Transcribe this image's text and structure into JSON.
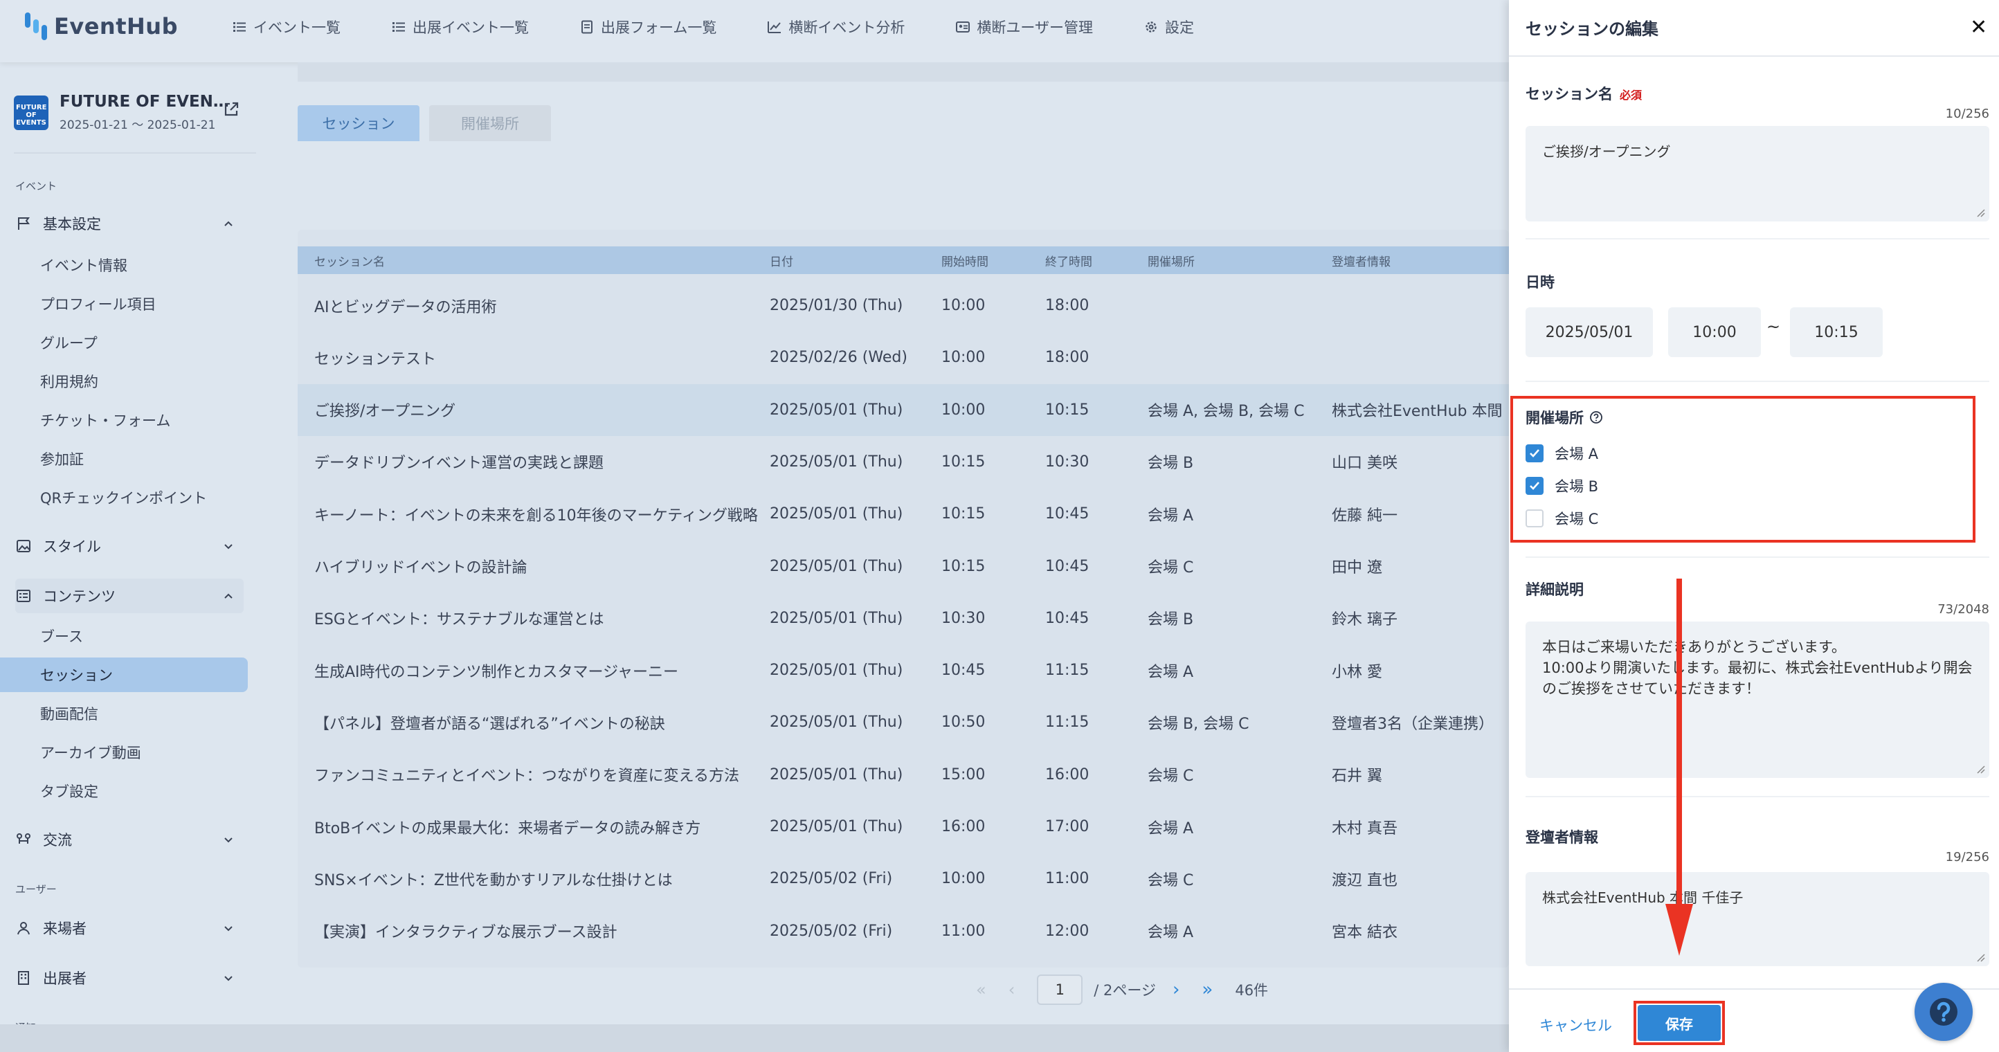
{
  "app": {
    "logo_text": "EventHub"
  },
  "nav": {
    "items": [
      {
        "label": "イベント一覧",
        "icon": "list-icon"
      },
      {
        "label": "出展イベント一覧",
        "icon": "list-icon"
      },
      {
        "label": "出展フォーム一覧",
        "icon": "document-icon"
      },
      {
        "label": "横断イベント分析",
        "icon": "chart-icon"
      },
      {
        "label": "横断ユーザー管理",
        "icon": "user-card-icon"
      },
      {
        "label": "設定",
        "icon": "gear-icon"
      }
    ]
  },
  "event": {
    "thumb_text": "FUTURE OF EVENTS",
    "name": "FUTURE OF EVEN…",
    "dates": "2025-01-21 ～ 2025-01-21"
  },
  "sidebar": {
    "section_event": "イベント",
    "basic": {
      "label": "基本設定",
      "icon": "flag-icon"
    },
    "basic_children": [
      "イベント情報",
      "プロフィール項目",
      "グループ",
      "利用規約",
      "チケット・フォーム",
      "参加証",
      "QRチェックインポイント"
    ],
    "style": {
      "label": "スタイル",
      "icon": "image-icon"
    },
    "contents": {
      "label": "コンテンツ",
      "icon": "contents-icon"
    },
    "contents_children": [
      "ブース",
      "セッション",
      "動画配信",
      "アーカイブ動画",
      "タブ設定"
    ],
    "exchange": {
      "label": "交流",
      "icon": "network-icon"
    },
    "section_user": "ユーザー",
    "visitors": {
      "label": "来場者",
      "icon": "person-icon"
    },
    "exhibitors": {
      "label": "出展者",
      "icon": "building-icon"
    },
    "section_notice": "通知"
  },
  "tabs": {
    "session": "セッション",
    "venue": "開催場所"
  },
  "table": {
    "headers": [
      "セッション名",
      "日付",
      "開始時間",
      "終了時間",
      "開催場所",
      "登壇者情報"
    ],
    "rows": [
      [
        "AIとビッグデータの活用術",
        "2025/01/30 (Thu)",
        "10:00",
        "18:00",
        "",
        ""
      ],
      [
        "セッションテスト",
        "2025/02/26 (Wed)",
        "10:00",
        "18:00",
        "",
        ""
      ],
      [
        "ご挨拶/オープニング",
        "2025/05/01 (Thu)",
        "10:00",
        "10:15",
        "会場 A, 会場 B, 会場 C",
        "株式会社EventHub 本間 千"
      ],
      [
        "データドリブンイベント運営の実践と課題",
        "2025/05/01 (Thu)",
        "10:15",
        "10:30",
        "会場 B",
        "山口 美咲"
      ],
      [
        "キーノート：イベントの未来を創る10年後のマーケティング戦略",
        "2025/05/01 (Thu)",
        "10:15",
        "10:45",
        "会場 A",
        "佐藤 純一"
      ],
      [
        "ハイブリッドイベントの設計論",
        "2025/05/01 (Thu)",
        "10:15",
        "10:45",
        "会場 C",
        "田中 遼"
      ],
      [
        "ESGとイベント：サステナブルな運営とは",
        "2025/05/01 (Thu)",
        "10:30",
        "10:45",
        "会場 B",
        "鈴木 璃子"
      ],
      [
        "生成AI時代のコンテンツ制作とカスタマージャーニー",
        "2025/05/01 (Thu)",
        "10:45",
        "11:15",
        "会場 A",
        "小林 愛"
      ],
      [
        "【パネル】登壇者が語る“選ばれる”イベントの秘訣",
        "2025/05/01 (Thu)",
        "10:50",
        "11:15",
        "会場 B, 会場 C",
        "登壇者3名（企業連携）"
      ],
      [
        "ファンコミュニティとイベント：つながりを資産に変える方法",
        "2025/05/01 (Thu)",
        "15:00",
        "16:00",
        "会場 C",
        "石井 翼"
      ],
      [
        "BtoBイベントの成果最大化：来場者データの読み解き方",
        "2025/05/01 (Thu)",
        "16:00",
        "17:00",
        "会場 A",
        "木村 真吾"
      ],
      [
        "SNS×イベント：Z世代を動かすリアルな仕掛けとは",
        "2025/05/02 (Fri)",
        "10:00",
        "11:00",
        "会場 C",
        "渡辺 直也"
      ],
      [
        "【実演】インタラクティブな展示ブース設計",
        "2025/05/02 (Fri)",
        "11:00",
        "12:00",
        "会場 A",
        "宮本 結衣"
      ]
    ]
  },
  "pager": {
    "page": "1",
    "total_pages": "/ 2ページ",
    "count": "46件"
  },
  "drawer": {
    "title": "セッションの編集",
    "name_label": "セッション名",
    "required": "必須",
    "name_counter": "10/256",
    "name_value": "ご挨拶/オープニング",
    "datetime_label": "日時",
    "date": "2025/05/01",
    "start": "10:00",
    "tilde": "~",
    "end": "10:15",
    "venue_label": "開催場所",
    "venues": [
      {
        "label": "会場 A",
        "checked": true
      },
      {
        "label": "会場 B",
        "checked": true
      },
      {
        "label": "会場 C",
        "checked": false
      }
    ],
    "desc_label": "詳細説明",
    "desc_counter": "73/2048",
    "desc_lines": [
      "本日はご来場いただきありがとうございます。",
      "10:00より開演いたします。最初に、株式会社EventHubより開会",
      "のご挨拶をさせていただきます！"
    ],
    "speaker_label": "登壇者情報",
    "speaker_counter": "19/256",
    "speaker_value": "株式会社EventHub 本間 千佳子",
    "cancel": "キャンセル",
    "save": "保存"
  },
  "colors": {
    "accent": "#2f87d6",
    "highlight": "#ea3323"
  }
}
